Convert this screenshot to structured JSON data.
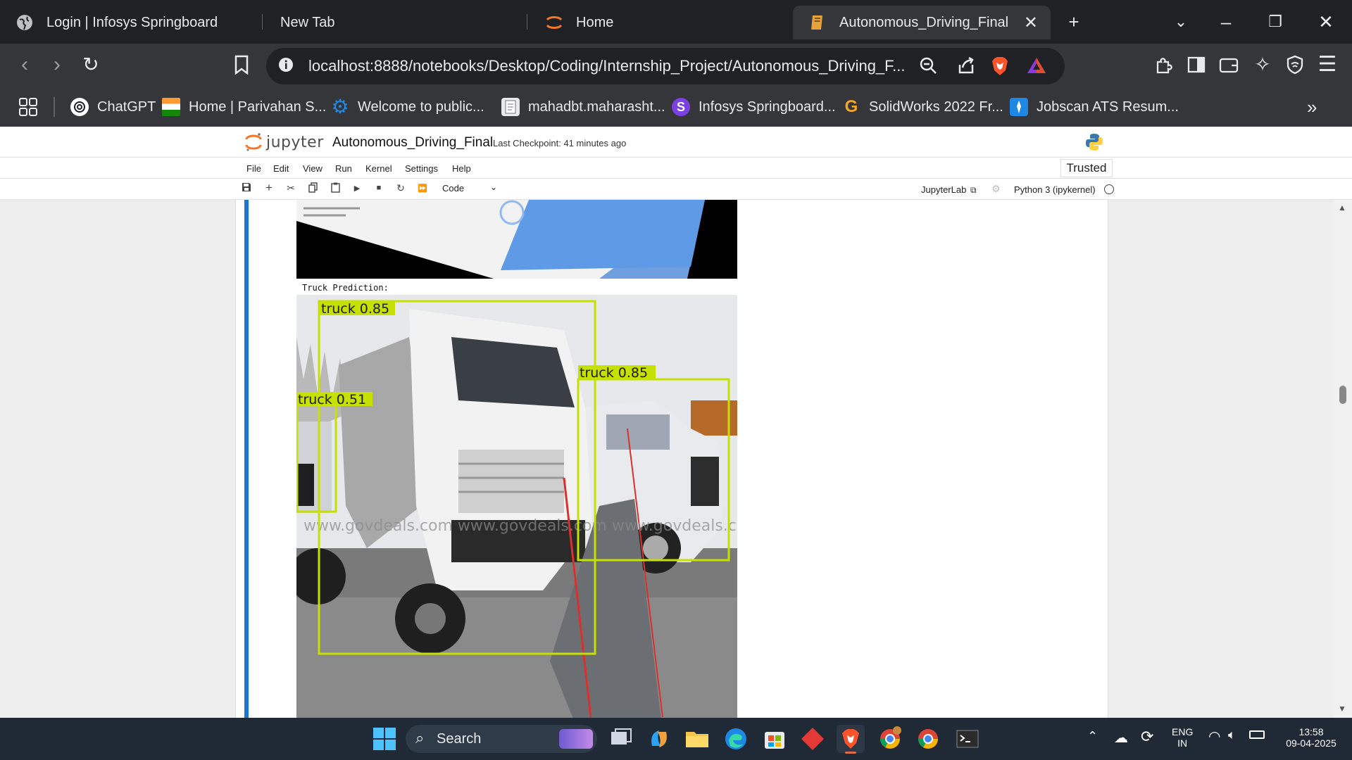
{
  "browser": {
    "tabs": [
      {
        "title": "Login | Infosys Springboard",
        "icon": "globe-icon"
      },
      {
        "title": "New Tab",
        "icon": ""
      },
      {
        "title": "Home",
        "icon": "jupyter-icon"
      },
      {
        "title": "Autonomous_Driving_Final",
        "icon": "notebook-icon",
        "active": true
      }
    ],
    "url": "localhost:8888/notebooks/Desktop/Coding/Internship_Project/Autonomous_Driving_F...",
    "bookmarks": [
      {
        "label": "ChatGPT",
        "icon": "chatgpt-icon"
      },
      {
        "label": "Home | Parivahan S...",
        "icon": "india-flag-icon"
      },
      {
        "label": "Welcome to public...",
        "icon": "gear-icon"
      },
      {
        "label": "mahadbt.maharasht...",
        "icon": "document-icon"
      },
      {
        "label": "Infosys Springboard...",
        "icon": "springboard-icon"
      },
      {
        "label": "SolidWorks 2022 Fr...",
        "icon": "g-icon"
      },
      {
        "label": "Jobscan ATS Resum...",
        "icon": "jobscan-icon"
      }
    ]
  },
  "jupyter": {
    "logo_text": "jupyter",
    "notebook_title": "Autonomous_Driving_Final",
    "checkpoint": "Last Checkpoint: 41 minutes ago",
    "menu": [
      "File",
      "Edit",
      "View",
      "Run",
      "Kernel",
      "Settings",
      "Help"
    ],
    "trusted": "Trusted",
    "cell_type": "Code",
    "jupyterlab_link": "JupyterLab",
    "kernel": "Python 3 (ipykernel)"
  },
  "output": {
    "label": "Truck Prediction:",
    "detections": [
      {
        "label": "truck 0.85"
      },
      {
        "label": "truck 0.85"
      },
      {
        "label": "truck 0.51"
      }
    ],
    "watermark": "www.govdeals.com"
  },
  "taskbar": {
    "search_placeholder": "Search",
    "lang_top": "ENG",
    "lang_bottom": "IN",
    "time": "13:58",
    "date": "09-04-2025"
  },
  "colors": {
    "cell_active": "#1976d2",
    "detection_box": "#c6e000",
    "jupyter_orange": "#f37726"
  }
}
